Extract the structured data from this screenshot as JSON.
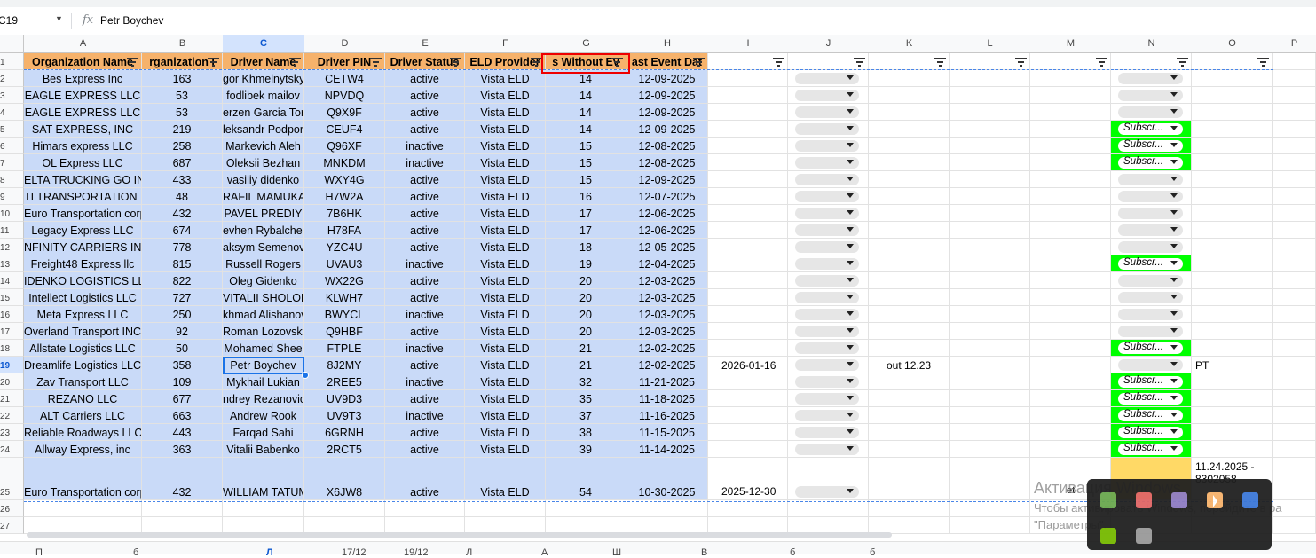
{
  "formula_bar": {
    "name_box": "C19",
    "fx_symbol": "fx",
    "value": "Petr Boychev"
  },
  "columns": [
    "A",
    "B",
    "C",
    "D",
    "E",
    "F",
    "G",
    "H",
    "I",
    "J",
    "K",
    "L",
    "M",
    "N",
    "O",
    "P"
  ],
  "header_row": [
    "Organization Name",
    "rganization I",
    "Driver Name",
    "Driver PIN",
    "Driver Status",
    "ELD Provider",
    "s Without Ev",
    "ast Event Dat"
  ],
  "rows": [
    {
      "n": "2",
      "org": "Bes Express Inc",
      "id": "163",
      "driver": "gor Khmelnytskyy",
      "pin": "CETW4",
      "status": "active",
      "eld": "Vista ELD",
      "days": "14",
      "date": "12-09-2025"
    },
    {
      "n": "3",
      "org": "EAGLE EXPRESS LLC",
      "id": "53",
      "driver": "fodlibek mailov",
      "pin": "NPVDQ",
      "status": "active",
      "eld": "Vista ELD",
      "days": "14",
      "date": "12-09-2025"
    },
    {
      "n": "4",
      "org": "EAGLE EXPRESS LLC",
      "id": "53",
      "driver": "erzen Garcia Torr",
      "pin": "Q9X9F",
      "status": "active",
      "eld": "Vista ELD",
      "days": "14",
      "date": "12-09-2025"
    },
    {
      "n": "5",
      "org": "SAT EXPRESS, INC",
      "id": "219",
      "driver": "leksandr Podpori",
      "pin": "CEUF4",
      "status": "active",
      "eld": "Vista ELD",
      "days": "14",
      "date": "12-09-2025"
    },
    {
      "n": "6",
      "org": "Himars express LLC",
      "id": "258",
      "driver": "Markevich Aleh",
      "pin": "Q96XF",
      "status": "inactive",
      "eld": "Vista ELD",
      "days": "15",
      "date": "12-08-2025"
    },
    {
      "n": "7",
      "org": "OL Express LLC",
      "id": "687",
      "driver": "Oleksii Bezhan",
      "pin": "MNKDM",
      "status": "inactive",
      "eld": "Vista ELD",
      "days": "15",
      "date": "12-08-2025"
    },
    {
      "n": "8",
      "org": "ELTA TRUCKING GO IN",
      "id": "433",
      "driver": "vasiliy didenko",
      "pin": "WXY4G",
      "status": "active",
      "eld": "Vista ELD",
      "days": "15",
      "date": "12-09-2025"
    },
    {
      "n": "9",
      "org": "TI TRANSPORTATION IN",
      "id": "48",
      "driver": "RAFIL MAMUKAD",
      "pin": "H7W2A",
      "status": "active",
      "eld": "Vista ELD",
      "days": "16",
      "date": "12-07-2025"
    },
    {
      "n": "10",
      "org": "Euro Transportation corp",
      "id": "432",
      "driver": "PAVEL PREDIY",
      "pin": "7B6HK",
      "status": "active",
      "eld": "Vista ELD",
      "days": "17",
      "date": "12-06-2025"
    },
    {
      "n": "11",
      "org": "Legacy Express LLC",
      "id": "674",
      "driver": "evhen Rybalchenk",
      "pin": "H78FA",
      "status": "active",
      "eld": "Vista ELD",
      "days": "17",
      "date": "12-06-2025"
    },
    {
      "n": "12",
      "org": "NFINITY CARRIERS INC",
      "id": "778",
      "driver": "aksym Semenovy",
      "pin": "YZC4U",
      "status": "active",
      "eld": "Vista ELD",
      "days": "18",
      "date": "12-05-2025"
    },
    {
      "n": "13",
      "org": "Freight48 Express llc",
      "id": "815",
      "driver": "Russell Rogers",
      "pin": "UVAU3",
      "status": "inactive",
      "eld": "Vista ELD",
      "days": "19",
      "date": "12-04-2025"
    },
    {
      "n": "14",
      "org": "IDENKO LOGISTICS LL",
      "id": "822",
      "driver": "Oleg Gidenko",
      "pin": "WX22G",
      "status": "active",
      "eld": "Vista ELD",
      "days": "20",
      "date": "12-03-2025"
    },
    {
      "n": "15",
      "org": "Intellect Logistics LLC",
      "id": "727",
      "driver": "VITALII SHOLOM",
      "pin": "KLWH7",
      "status": "active",
      "eld": "Vista ELD",
      "days": "20",
      "date": "12-03-2025"
    },
    {
      "n": "16",
      "org": "Meta Express LLC",
      "id": "250",
      "driver": "khmad Alishanov",
      "pin": "BWYCL",
      "status": "inactive",
      "eld": "Vista ELD",
      "days": "20",
      "date": "12-03-2025"
    },
    {
      "n": "17",
      "org": "Overland Transport INC",
      "id": "92",
      "driver": "Roman Lozovskyy",
      "pin": "Q9HBF",
      "status": "active",
      "eld": "Vista ELD",
      "days": "20",
      "date": "12-03-2025"
    },
    {
      "n": "18",
      "org": "Allstate Logistics LLC",
      "id": "50",
      "driver": "Mohamed Shee",
      "pin": "FTPLE",
      "status": "inactive",
      "eld": "Vista ELD",
      "days": "21",
      "date": "12-02-2025"
    },
    {
      "n": "19",
      "org": "Dreamlife Logistics LLC",
      "id": "358",
      "driver": "Petr Boychev",
      "pin": "8J2MY",
      "status": "active",
      "eld": "Vista ELD",
      "days": "21",
      "date": "12-02-2025"
    },
    {
      "n": "20",
      "org": "Zav Transport LLC",
      "id": "109",
      "driver": "Mykhail Lukian",
      "pin": "2REE5",
      "status": "inactive",
      "eld": "Vista ELD",
      "days": "32",
      "date": "11-21-2025"
    },
    {
      "n": "21",
      "org": "REZANO LLC",
      "id": "677",
      "driver": "ndrey Rezanovic",
      "pin": "UV9D3",
      "status": "active",
      "eld": "Vista ELD",
      "days": "35",
      "date": "11-18-2025"
    },
    {
      "n": "22",
      "org": "ALT Carriers LLC",
      "id": "663",
      "driver": "Andrew Rook",
      "pin": "UV9T3",
      "status": "inactive",
      "eld": "Vista ELD",
      "days": "37",
      "date": "11-16-2025"
    },
    {
      "n": "23",
      "org": "Reliable Roadways LLC",
      "id": "443",
      "driver": "Farqad Sahi",
      "pin": "6GRNH",
      "status": "active",
      "eld": "Vista ELD",
      "days": "38",
      "date": "11-15-2025"
    },
    {
      "n": "24",
      "org": "Allway Express, inc",
      "id": "363",
      "driver": "Vitalii Babenko",
      "pin": "2RCT5",
      "status": "active",
      "eld": "Vista ELD",
      "days": "39",
      "date": "11-14-2025"
    },
    {
      "n": "25",
      "org": "Euro Transportation corp",
      "id": "432",
      "driver": "WILLIAM TATUM",
      "pin": "X6JW8",
      "status": "active",
      "eld": "Vista ELD",
      "days": "54",
      "date": "10-30-2025"
    }
  ],
  "extra_rows": [
    "26",
    "27"
  ],
  "subscr_label": "Subscr...",
  "row19": {
    "i_value": "2026-01-16",
    "k_value": "out 12.23",
    "o_value": "PT"
  },
  "row25": {
    "i_value": "2025-12-30",
    "o_value_line1": "11.24.2025 -",
    "o_value_line2": "8302058"
  },
  "partial_text": "et",
  "row1_header": "1",
  "sheet_tabs": [
    "П",
    "б",
    "Л",
    "17/12",
    "19/12",
    "Л",
    "А",
    "Ш",
    "В",
    "б",
    "б"
  ],
  "watermark": {
    "title": "Активация Windows",
    "line1": "Чтобы активировать Windows, перейдите в ра",
    "line2": "\"Параметры\"."
  },
  "tray_icons": [
    "app-icon-1",
    "app-icon-2",
    "app-icon-3",
    "app-icon-4",
    "app-icon-5",
    "nvidia-icon",
    "keyboard-icon"
  ],
  "colors": {
    "selected_blue": "#c9daf8",
    "header_orange": "#f6b26b",
    "subscr_green": "#00ff00",
    "yellow": "#ffd966",
    "highlight_red": "#ee0000"
  }
}
